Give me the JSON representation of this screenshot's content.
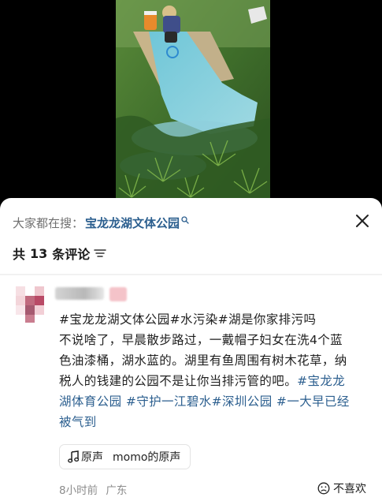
{
  "video": {
    "description_icon": "video-frame"
  },
  "search": {
    "prefix": "大家都在搜：",
    "term": "宝龙龙湖文体公园",
    "icon": "search-icon"
  },
  "close": {
    "icon": "close-icon"
  },
  "comments_header": {
    "prefix": "共",
    "count": "13",
    "suffix": "条评论",
    "sort_icon": "sort-icon"
  },
  "comment": {
    "line1": "#宝龙龙湖文体公园#水污染#湖是你家排污吗",
    "line2": "不说啥了，早晨散步路过，一戴帽子妇女在洗4个蓝",
    "line3": "色油漆桶，湖水蓝的。湖里有鱼周围有树木花草，纳",
    "line4_plain": "税人的钱建的公园不是让你当排污管的吧。",
    "line4_tag": "#宝龙龙",
    "line5": "湖体育公园 #守护一江碧水#深圳公园 #一大早已经",
    "line6": "被气到",
    "sound": {
      "label": "原声",
      "source": "momo的原声",
      "icon": "music-note-icon"
    },
    "time": "8小时前",
    "location": "广东",
    "dislike": {
      "label": "不喜欢",
      "icon": "sad-face-icon"
    }
  },
  "colors": {
    "link": "#2c5f8f",
    "text": "#1f1f1f",
    "muted": "#8c8c8c",
    "background": "#ffffff",
    "backdrop": "#000000"
  }
}
